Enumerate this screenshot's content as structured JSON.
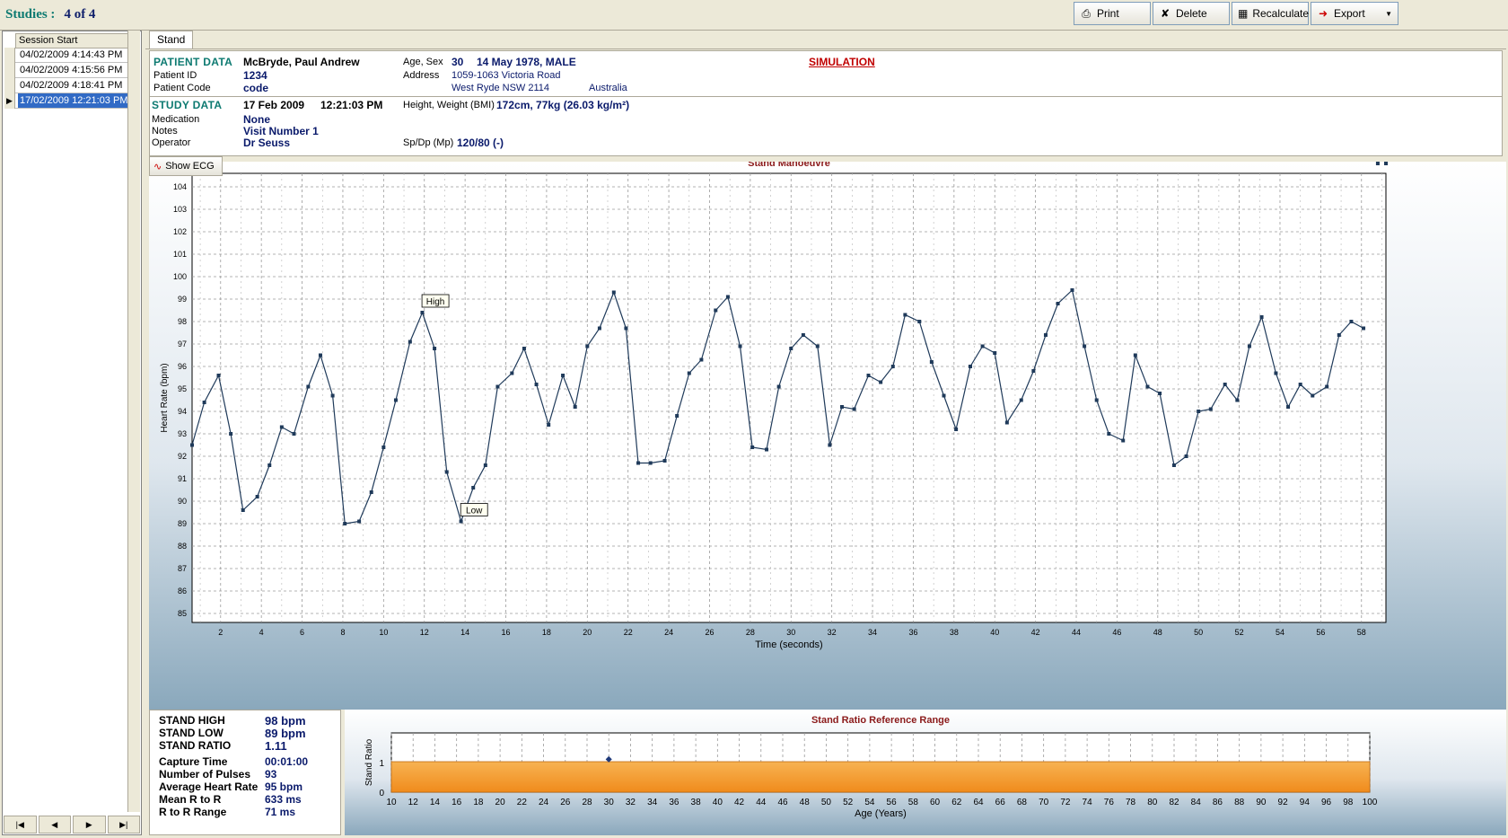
{
  "header": {
    "studies_label": "Studies :",
    "studies_count": "4 of 4"
  },
  "toolbar": {
    "print": "Print",
    "delete": "Delete",
    "recalculate": "Recalculate",
    "export": "Export"
  },
  "sessions": {
    "header": "Session Start",
    "rows": [
      "04/02/2009 4:14:43 PM",
      "04/02/2009 4:15:56 PM",
      "04/02/2009 4:18:41 PM",
      "17/02/2009 12:21:03 PM"
    ],
    "selected_index": 3
  },
  "tab": {
    "label": "Stand"
  },
  "patient": {
    "section": "PATIENT DATA",
    "name": "McBryde, Paul Andrew",
    "id_label": "Patient ID",
    "id": "1234",
    "code_label": "Patient Code",
    "code": "code",
    "age_sex_label": "Age, Sex",
    "age": "30",
    "dob_sex": "14 May 1978, MALE",
    "address_label": "Address",
    "address1": "1059-1063 Victoria Road",
    "address2": "West Ryde NSW 2114",
    "country": "Australia",
    "mode": "SIMULATION"
  },
  "study": {
    "section": "STUDY DATA",
    "date": "17 Feb 2009",
    "time": "12:21:03 PM",
    "hw_label": "Height, Weight (BMI)",
    "hw": "172cm, 77kg (26.03 kg/m²)",
    "medication_label": "Medication",
    "medication": "None",
    "notes_label": "Notes",
    "notes": "Visit Number 1",
    "operator_label": "Operator",
    "operator": "Dr Seuss",
    "spdp_label": "Sp/Dp (Mp)",
    "spdp": "120/80 (-)"
  },
  "show_ecg": "Show ECG",
  "stats": {
    "items": [
      {
        "label": "STAND HIGH",
        "value": "98 bpm"
      },
      {
        "label": "STAND LOW",
        "value": "89 bpm"
      },
      {
        "label": "STAND RATIO",
        "value": "1.11"
      },
      {
        "label": "Capture Time",
        "value": "00:01:00"
      },
      {
        "label": "Number of Pulses",
        "value": "93"
      },
      {
        "label": "Average Heart Rate",
        "value": "95 bpm"
      },
      {
        "label": "Mean R to R",
        "value": "633 ms"
      },
      {
        "label": "R to R Range",
        "value": "71 ms"
      }
    ]
  },
  "chart_data": [
    {
      "type": "line",
      "title": "Stand Manoeuvre",
      "xlabel": "Time (seconds)",
      "ylabel": "Heart Rate (bpm)",
      "xlim": [
        0.6,
        59.2
      ],
      "ylim": [
        84.6,
        104.6
      ],
      "xticks": [
        2,
        4,
        6,
        8,
        10,
        12,
        14,
        16,
        18,
        20,
        22,
        24,
        26,
        28,
        30,
        32,
        34,
        36,
        38,
        40,
        42,
        44,
        46,
        48,
        50,
        52,
        54,
        56,
        58
      ],
      "yticks": [
        85,
        86,
        87,
        88,
        89,
        90,
        91,
        92,
        93,
        94,
        95,
        96,
        97,
        98,
        99,
        100,
        101,
        102,
        103,
        104
      ],
      "grid": true,
      "color": "#1f3a5a",
      "x": [
        0.6,
        1.2,
        1.9,
        2.5,
        3.1,
        3.8,
        4.4,
        5.0,
        5.6,
        6.3,
        6.9,
        7.5,
        8.1,
        8.8,
        9.4,
        10.0,
        10.6,
        11.3,
        11.9,
        12.5,
        13.1,
        13.8,
        14.4,
        15.0,
        15.6,
        16.3,
        16.9,
        17.5,
        18.1,
        18.8,
        19.4,
        20.0,
        20.6,
        21.3,
        21.9,
        22.5,
        23.1,
        23.8,
        24.4,
        25.0,
        25.6,
        26.3,
        26.9,
        27.5,
        28.1,
        28.8,
        29.4,
        30.0,
        30.6,
        31.3,
        31.9,
        32.5,
        33.1,
        33.8,
        34.4,
        35.0,
        35.6,
        36.3,
        36.9,
        37.5,
        38.1,
        38.8,
        39.4,
        40.0,
        40.6,
        41.3,
        41.9,
        42.5,
        43.1,
        43.8,
        44.4,
        45.0,
        45.6,
        46.3,
        46.9,
        47.5,
        48.1,
        48.8,
        49.4,
        50.0,
        50.6,
        51.3,
        51.9,
        52.5,
        53.1,
        53.8,
        54.4,
        55.0,
        55.6,
        56.3,
        56.9,
        57.5,
        58.1,
        58.8,
        59.2
      ],
      "y": [
        92.5,
        94.4,
        95.6,
        93.0,
        89.6,
        90.2,
        91.6,
        93.3,
        93.0,
        95.1,
        96.5,
        94.7,
        89.0,
        89.1,
        90.4,
        92.4,
        94.5,
        97.1,
        98.4,
        96.8,
        91.3,
        89.1,
        90.6,
        91.6,
        95.1,
        95.7,
        96.8,
        95.2,
        93.4,
        95.6,
        94.2,
        96.9,
        97.7,
        99.3,
        97.7,
        91.7,
        91.7,
        91.8,
        93.8,
        95.7,
        96.3,
        98.5,
        99.1,
        96.9,
        92.4,
        92.3,
        95.1,
        96.8,
        97.4,
        96.9,
        92.5,
        94.2,
        94.1,
        95.6,
        95.3,
        96.0,
        98.3,
        98.0,
        96.2,
        94.7,
        93.2,
        96.0,
        96.9,
        96.6,
        93.5,
        94.5,
        95.8,
        97.4,
        98.8,
        99.4,
        96.9,
        94.5,
        93.0,
        92.7,
        96.5,
        95.1,
        94.8,
        91.6,
        92.0,
        94.0,
        94.1,
        95.2,
        94.5,
        96.9,
        98.2,
        95.7,
        94.2,
        95.2,
        94.7,
        95.1,
        97.4,
        98.0,
        97.7
      ],
      "annotations": [
        {
          "text": "High",
          "x": 12.5,
          "y": 98.4
        },
        {
          "text": "Low",
          "x": 14.4,
          "y": 89.1
        }
      ]
    },
    {
      "type": "area",
      "title": "Stand Ratio Reference Range",
      "xlabel": "Age (Years)",
      "ylabel": "Stand Ratio",
      "xlim": [
        10,
        100
      ],
      "ylim": [
        0,
        2
      ],
      "xticks": [
        10,
        12,
        14,
        16,
        18,
        20,
        22,
        24,
        26,
        28,
        30,
        32,
        34,
        36,
        38,
        40,
        42,
        44,
        46,
        48,
        50,
        52,
        54,
        56,
        58,
        60,
        62,
        64,
        66,
        68,
        70,
        72,
        74,
        76,
        78,
        80,
        82,
        84,
        86,
        88,
        90,
        92,
        94,
        96,
        98,
        100
      ],
      "yticks": [
        0,
        1
      ],
      "band": {
        "low": 0,
        "high": 1.03
      },
      "point": {
        "x": 30,
        "y": 1.11
      },
      "grid": true
    }
  ]
}
